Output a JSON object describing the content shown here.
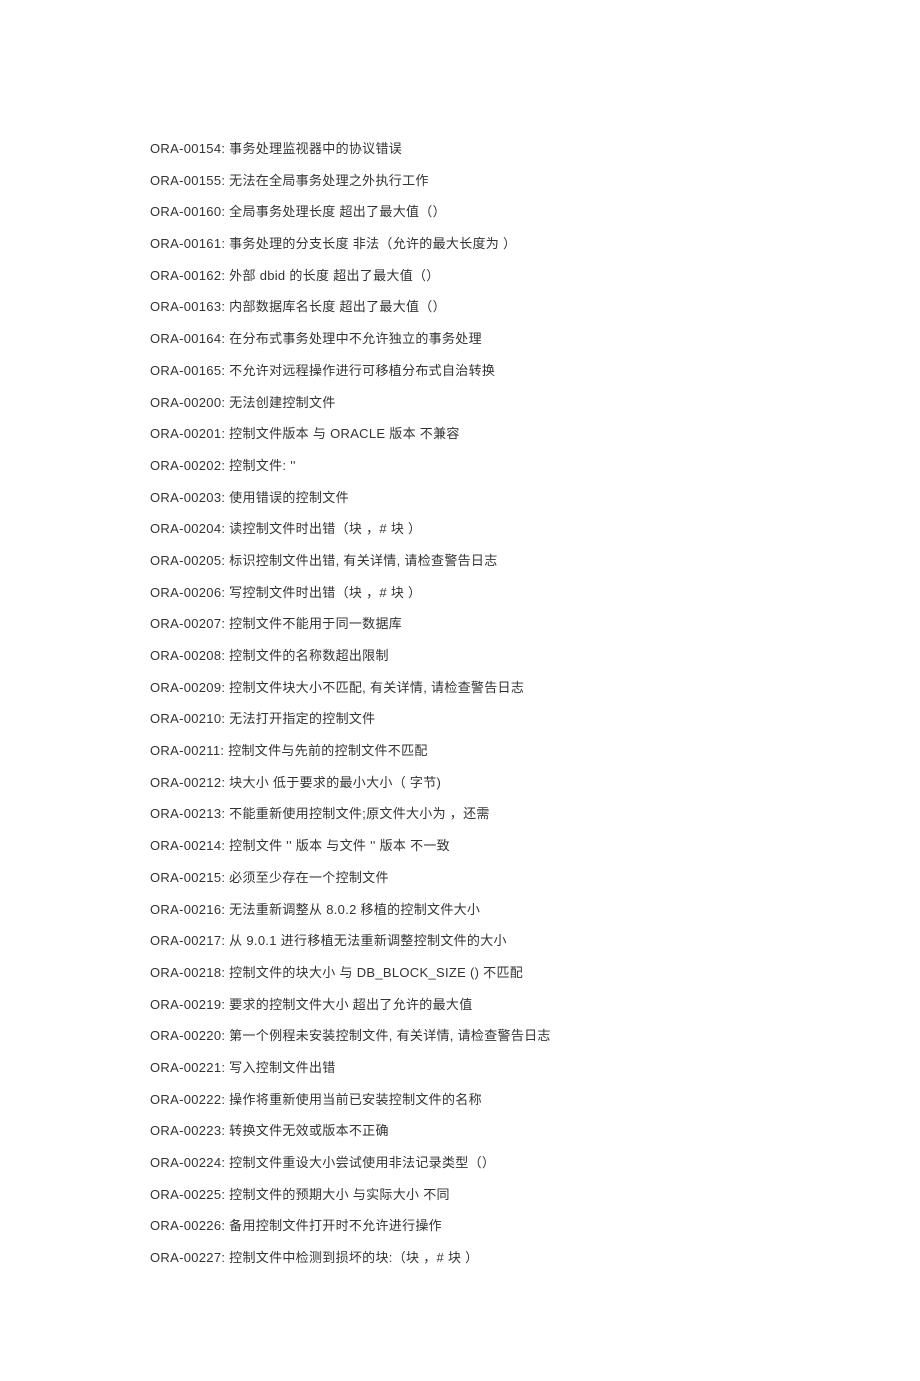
{
  "errors": [
    {
      "code": "ORA-00154:",
      "desc": "事务处理监视器中的协议错误"
    },
    {
      "code": "ORA-00155:",
      "desc": "无法在全局事务处理之外执行工作"
    },
    {
      "code": "ORA-00160:",
      "desc": "全局事务处理长度   超出了最大值（）"
    },
    {
      "code": "ORA-00161:",
      "desc": "事务处理的分支长度   非法（允许的最大长度为  ）"
    },
    {
      "code": "ORA-00162:",
      "desc": "外部 dbid 的长度   超出了最大值（）"
    },
    {
      "code": "ORA-00163:",
      "desc": "内部数据库名长度   超出了最大值（）"
    },
    {
      "code": "ORA-00164:",
      "desc": "在分布式事务处理中不允许独立的事务处理"
    },
    {
      "code": "ORA-00165:",
      "desc": "不允许对远程操作进行可移植分布式自治转换"
    },
    {
      "code": "ORA-00200:",
      "desc": "无法创建控制文件"
    },
    {
      "code": "ORA-00201:",
      "desc": "控制文件版本   与 ORACLE 版本   不兼容"
    },
    {
      "code": "ORA-00202:",
      "desc": "控制文件: ''"
    },
    {
      "code": "ORA-00203:",
      "desc": "使用错误的控制文件"
    },
    {
      "code": "ORA-00204:",
      "desc": "读控制文件时出错（块 ，# 块 ）"
    },
    {
      "code": "ORA-00205:",
      "desc": "标识控制文件出错, 有关详情, 请检查警告日志"
    },
    {
      "code": "ORA-00206:",
      "desc": "写控制文件时出错（块 ，# 块 ）"
    },
    {
      "code": "ORA-00207:",
      "desc": "控制文件不能用于同一数据库"
    },
    {
      "code": "ORA-00208:",
      "desc": "控制文件的名称数超出限制"
    },
    {
      "code": "ORA-00209:",
      "desc": "控制文件块大小不匹配, 有关详情, 请检查警告日志"
    },
    {
      "code": "ORA-00210:",
      "desc": "无法打开指定的控制文件"
    },
    {
      "code": "ORA-00211:",
      "desc": "控制文件与先前的控制文件不匹配"
    },
    {
      "code": "ORA-00212:",
      "desc": "块大小   低于要求的最小大小（  字节)"
    },
    {
      "code": "ORA-00213:",
      "desc": "不能重新使用控制文件;原文件大小为 ，还需"
    },
    {
      "code": "ORA-00214:",
      "desc": "控制文件 '' 版本   与文件  '' 版本   不一致"
    },
    {
      "code": "ORA-00215:",
      "desc": "必须至少存在一个控制文件"
    },
    {
      "code": "ORA-00216:",
      "desc": "无法重新调整从 8.0.2 移植的控制文件大小"
    },
    {
      "code": "ORA-00217:",
      "desc": "从 9.0.1 进行移植无法重新调整控制文件的大小"
    },
    {
      "code": "ORA-00218:",
      "desc": "控制文件的块大小   与 DB_BLOCK_SIZE () 不匹配"
    },
    {
      "code": "ORA-00219:",
      "desc": "要求的控制文件大小   超出了允许的最大值"
    },
    {
      "code": "ORA-00220:",
      "desc": "第一个例程未安装控制文件, 有关详情, 请检查警告日志"
    },
    {
      "code": "ORA-00221:",
      "desc": "写入控制文件出错"
    },
    {
      "code": "ORA-00222:",
      "desc": "操作将重新使用当前已安装控制文件的名称"
    },
    {
      "code": "ORA-00223:",
      "desc": "转换文件无效或版本不正确"
    },
    {
      "code": "ORA-00224:",
      "desc": "控制文件重设大小尝试使用非法记录类型（）"
    },
    {
      "code": "ORA-00225:",
      "desc": "控制文件的预期大小   与实际大小   不同"
    },
    {
      "code": "ORA-00226:",
      "desc": "备用控制文件打开时不允许进行操作"
    },
    {
      "code": "ORA-00227:",
      "desc": "控制文件中检测到损坏的块:（块 ，# 块 ）"
    }
  ]
}
